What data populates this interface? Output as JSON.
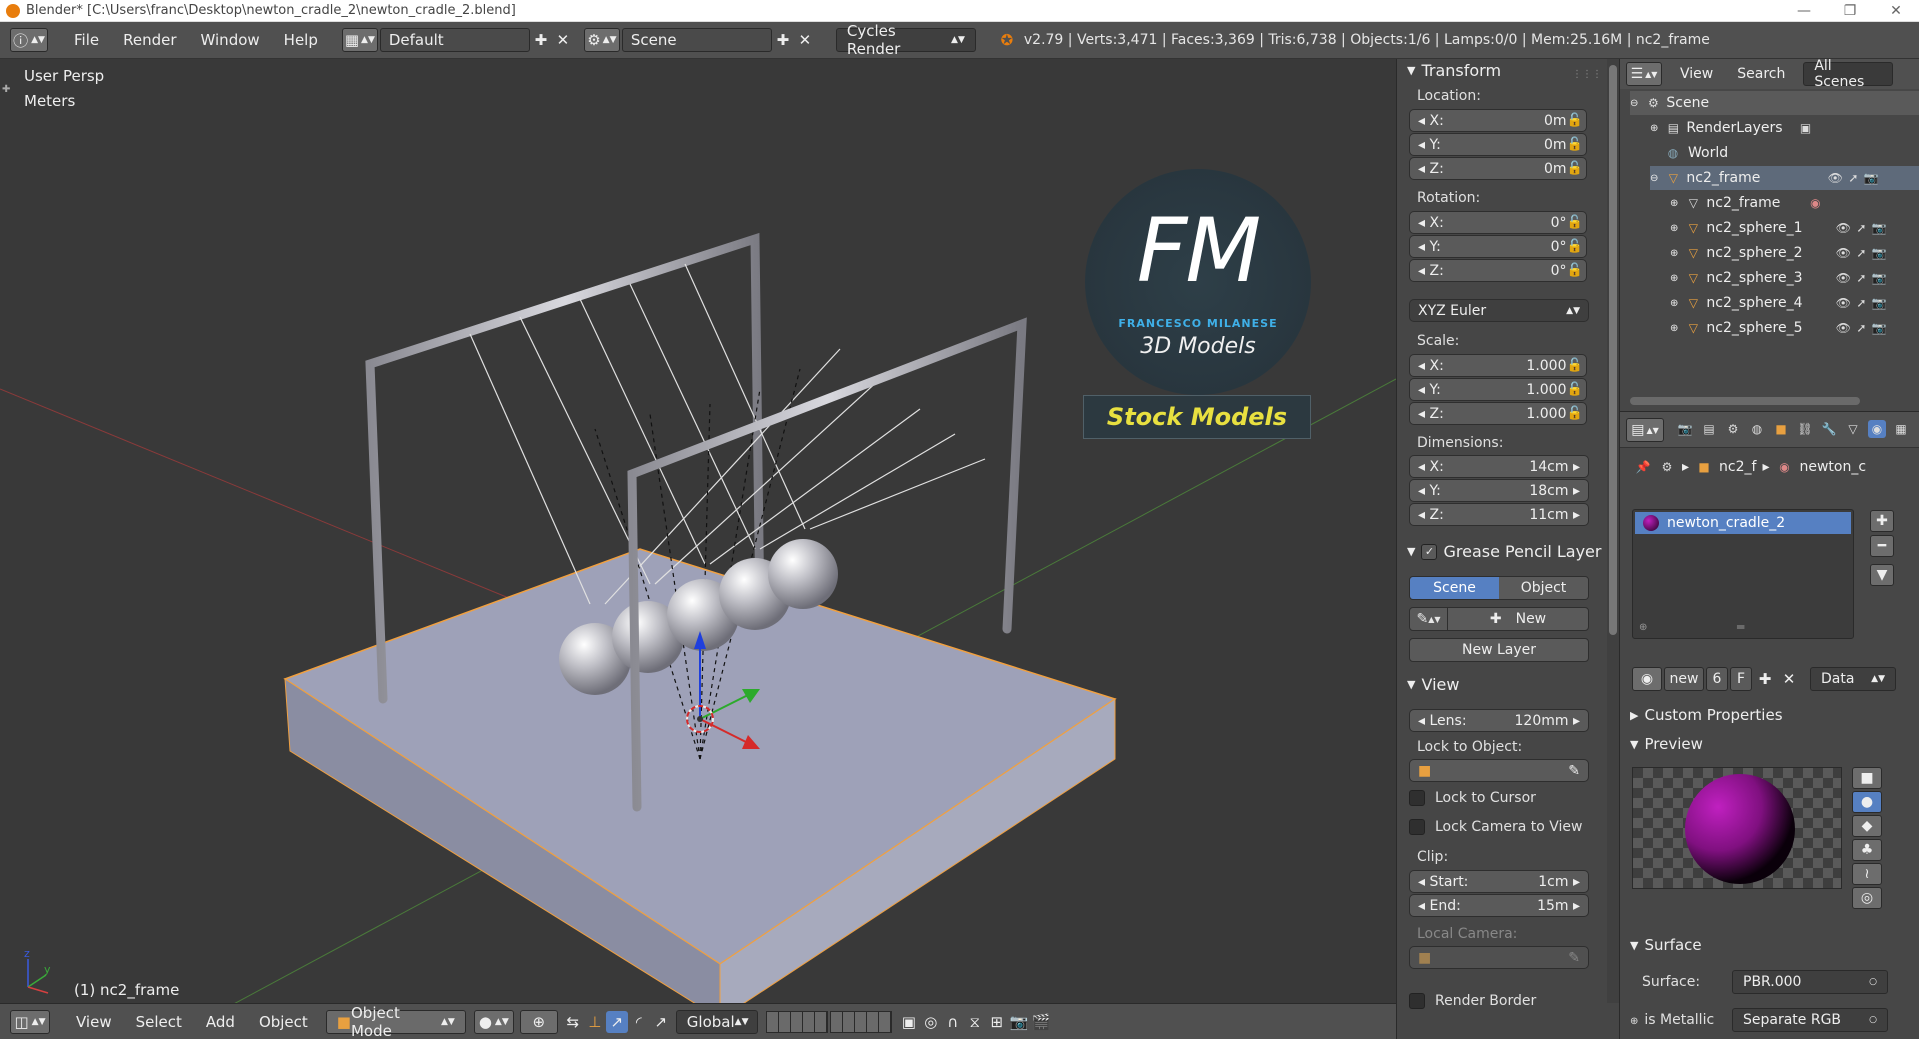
{
  "window": {
    "title": "Blender* [C:\\Users\\franc\\Desktop\\newton_cradle_2\\newton_cradle_2.blend]",
    "controls": [
      "—",
      "❐",
      "✕"
    ]
  },
  "header": {
    "menus": [
      "File",
      "Render",
      "Window",
      "Help"
    ],
    "screen_layout": "Default",
    "scene": "Scene",
    "render_engine": "Cycles Render",
    "stats": "v2.79 | Verts:3,471 | Faces:3,369 | Tris:6,738 | Objects:1/6 | Lamps:0/0 | Mem:25.16M | nc2_frame"
  },
  "viewport": {
    "view_name": "User Persp",
    "units": "Meters",
    "object_label": "(1) nc2_frame",
    "watermark": {
      "initials": "FM",
      "name": "FRANCESCO MILANESE",
      "subtitle": "3D Models",
      "banner": "Stock Models"
    }
  },
  "bottombar": {
    "menus": [
      "View",
      "Select",
      "Add",
      "Object"
    ],
    "mode": "Object Mode",
    "orientation": "Global"
  },
  "npanel": {
    "transform": {
      "title": "Transform",
      "location_label": "Location:",
      "location": [
        {
          "axis": "X:",
          "value": "0m"
        },
        {
          "axis": "Y:",
          "value": "0m"
        },
        {
          "axis": "Z:",
          "value": "0m"
        }
      ],
      "rotation_label": "Rotation:",
      "rotation": [
        {
          "axis": "X:",
          "value": "0°"
        },
        {
          "axis": "Y:",
          "value": "0°"
        },
        {
          "axis": "Z:",
          "value": "0°"
        }
      ],
      "rotation_mode": "XYZ Euler",
      "scale_label": "Scale:",
      "scale": [
        {
          "axis": "X:",
          "value": "1.000"
        },
        {
          "axis": "Y:",
          "value": "1.000"
        },
        {
          "axis": "Z:",
          "value": "1.000"
        }
      ],
      "dimensions_label": "Dimensions:",
      "dimensions": [
        {
          "axis": "X:",
          "value": "14cm"
        },
        {
          "axis": "Y:",
          "value": "18cm"
        },
        {
          "axis": "Z:",
          "value": "11cm"
        }
      ]
    },
    "grease_pencil": {
      "title": "Grease Pencil Layer",
      "tab_scene": "Scene",
      "tab_object": "Object",
      "new_label": "New",
      "new_layer_label": "New Layer"
    },
    "view": {
      "title": "View",
      "lens_label": "Lens:",
      "lens_value": "120mm",
      "lock_object_label": "Lock to Object:",
      "lock_cursor_label": "Lock to Cursor",
      "lock_camera_label": "Lock Camera to View",
      "clip_label": "Clip:",
      "clip_start_label": "Start:",
      "clip_start_value": "1cm",
      "clip_end_label": "End:",
      "clip_end_value": "15m",
      "local_camera_label": "Local Camera:",
      "render_border_label": "Render Border"
    }
  },
  "outliner": {
    "view_menu": "View",
    "search_menu": "Search",
    "filter": "All Scenes",
    "rows": [
      {
        "label": "Scene",
        "indent": 0
      },
      {
        "label": "RenderLayers",
        "indent": 1
      },
      {
        "label": "World",
        "indent": 1
      },
      {
        "label": "nc2_frame",
        "indent": 1
      },
      {
        "label": "nc2_frame",
        "indent": 2
      },
      {
        "label": "nc2_sphere_1",
        "indent": 2
      },
      {
        "label": "nc2_sphere_2",
        "indent": 2
      },
      {
        "label": "nc2_sphere_3",
        "indent": 2
      },
      {
        "label": "nc2_sphere_4",
        "indent": 2
      },
      {
        "label": "nc2_sphere_5",
        "indent": 2
      }
    ]
  },
  "properties": {
    "breadcrumb": [
      "nc2_f",
      "newton_c"
    ],
    "material_slot": "newton_cradle_2",
    "datablock": {
      "name": "new",
      "users": "6",
      "fake": "F",
      "link": "Data"
    },
    "custom_properties": "Custom Properties",
    "preview": "Preview",
    "surface_panel": "Surface",
    "surface_label": "Surface:",
    "surface_value": "PBR.000",
    "metallic_label": "is Metallic",
    "metallic_value": "Separate RGB"
  }
}
